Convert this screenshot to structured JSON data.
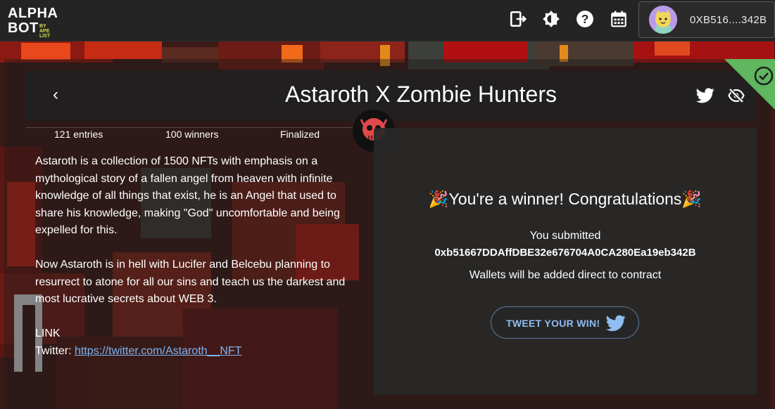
{
  "header": {
    "logo_line1": "ALPHA",
    "logo_line2": "BOT",
    "logo_by": "BY",
    "logo_sub": "APE LIST",
    "icons": [
      "exit-icon",
      "brightness-icon",
      "help-icon",
      "calendar-icon"
    ],
    "wallet_address": "0XB516....342B"
  },
  "raffle": {
    "title": "Astaroth X Zombie Hunters",
    "entries": "121 entries",
    "winners": "100 winners",
    "status": "Finalized",
    "description_p1": "Astaroth is a collection of 1500 NFTs with emphasis on a mythological story of a fallen angel from heaven with infinite knowledge of all things that exist, he is an Angel that used to share his knowledge, making \"God\" uncomfortable and being expelled for this.",
    "description_p2": "Now Astaroth is in hell with Lucifer and Belcebu planning to resurrect to atone for all our sins and teach us the darkest and most lucrative secrets about WEB 3.",
    "link_heading": "LINK",
    "twitter_label": "Twitter:",
    "twitter_url": "https://twitter.com/Astaroth__NFT"
  },
  "result": {
    "headline": "🎉You're a winner! Congratulations🎉",
    "submitted_label": "You submitted",
    "submitted_wallet": "0xb51667DDAffDBE32e676704A0CA280Ea19eb342B",
    "note": "Wallets will be added direct to contract",
    "tweet_button": "TWEET YOUR WIN!"
  },
  "colors": {
    "accent_green": "#5fb760",
    "link_blue": "#7db4f5",
    "logo_yellow": "#d7e04a"
  }
}
